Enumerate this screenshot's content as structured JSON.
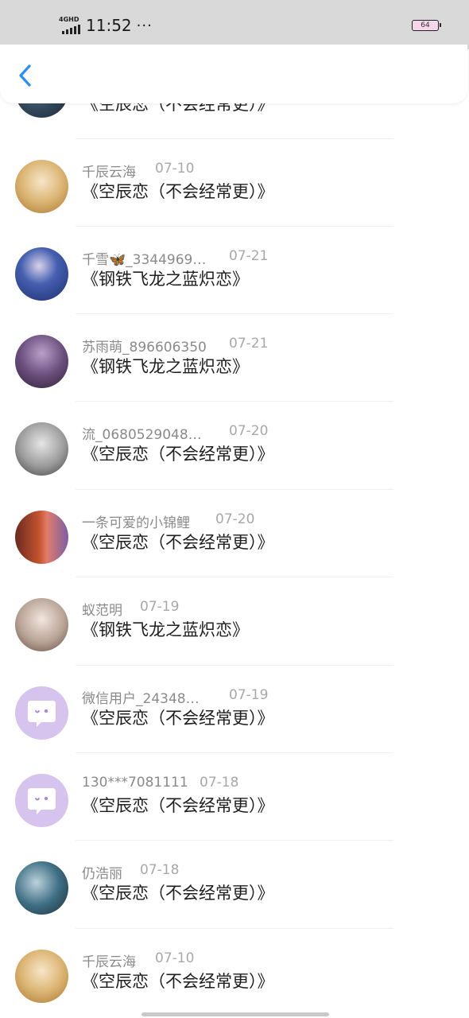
{
  "status_bar": {
    "network": "4GHD",
    "time": "11:52",
    "dots": "···",
    "battery": "64"
  },
  "nav": {
    "back_icon": "chevron-left-icon",
    "accent_color": "#2b8ff0"
  },
  "items": [
    {
      "name": "",
      "date": "",
      "text": "《空辰恋（不会经常更）》",
      "avatar": "photo-avatar-dark"
    },
    {
      "name": "千辰云海",
      "date": "07-10",
      "text": "《空辰恋（不会经常更）》",
      "avatar": "photo-avatar-gold"
    },
    {
      "name": "千雪🦋_3344969…",
      "date": "07-21",
      "text": "《钢铁飞龙之蓝炽恋》",
      "avatar": "photo-avatar-blue"
    },
    {
      "name": "苏雨萌_896606350",
      "date": "07-21",
      "text": "《钢铁飞龙之蓝炽恋》",
      "avatar": "photo-avatar-purple"
    },
    {
      "name": "流_0680529048…",
      "date": "07-20",
      "text": "《空辰恋（不会经常更）》",
      "avatar": "photo-avatar-gray"
    },
    {
      "name": "一条可爱的小锦鲤",
      "date": "07-20",
      "text": "《空辰恋（不会经常更）》",
      "avatar": "photo-avatar-orange"
    },
    {
      "name": "蚁范明",
      "date": "07-19",
      "text": "《钢铁飞龙之蓝炽恋》",
      "avatar": "photo-avatar-light"
    },
    {
      "name": "微信用户_24348…",
      "date": "07-19",
      "text": "《空辰恋（不会经常更）》",
      "avatar": "chat-bubble-avatar"
    },
    {
      "name": "130***7081111",
      "date": "07-18",
      "text": "《空辰恋（不会经常更）》",
      "avatar": "chat-bubble-avatar"
    },
    {
      "name": "仍浩丽",
      "date": "07-18",
      "text": "《空辰恋（不会经常更）》",
      "avatar": "photo-avatar-sea"
    },
    {
      "name": "千辰云海",
      "date": "07-10",
      "text": "《空辰恋（不会经常更）》",
      "avatar": "photo-avatar-gold"
    }
  ]
}
